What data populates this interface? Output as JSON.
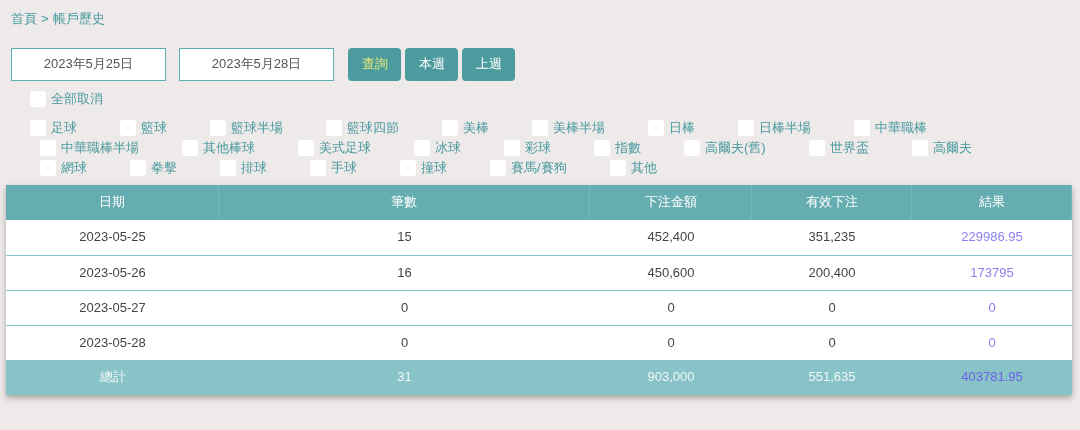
{
  "breadcrumb": [
    "首頁",
    ">",
    "帳戶歷史"
  ],
  "date_from": {
    "value": "2023年5月25日"
  },
  "date_to": {
    "value": "2023年5月28日"
  },
  "buttons": [
    {
      "label": "查詢",
      "selected": true
    },
    {
      "label": "本週",
      "selected": false
    },
    {
      "label": "上週",
      "selected": false
    }
  ],
  "clear_all": {
    "label": "全部取消",
    "checked": false
  },
  "sport_rows": [
    [
      {
        "label": "足球",
        "checked": false
      },
      {
        "label": "籃球",
        "checked": false
      },
      {
        "label": "籃球半場",
        "checked": false
      },
      {
        "label": "籃球四節",
        "checked": false
      },
      {
        "label": "美棒",
        "checked": false
      },
      {
        "label": "美棒半場",
        "checked": false
      },
      {
        "label": "日棒",
        "checked": false
      },
      {
        "label": "日棒半場",
        "checked": false
      },
      {
        "label": "中華職棒",
        "checked": false
      }
    ],
    [
      {
        "label": "中華職棒半場",
        "checked": false
      },
      {
        "label": "其他棒球",
        "checked": false
      },
      {
        "label": "美式足球",
        "checked": false
      },
      {
        "label": "冰球",
        "checked": false
      },
      {
        "label": "彩球",
        "checked": false
      },
      {
        "label": "指數",
        "checked": false
      },
      {
        "label": "高爾夫(舊)",
        "checked": false
      },
      {
        "label": "世界盃",
        "checked": false
      },
      {
        "label": "高爾夫",
        "checked": false
      }
    ],
    [
      {
        "label": "網球",
        "checked": false
      },
      {
        "label": "拳擊",
        "checked": false
      },
      {
        "label": "排球",
        "checked": false
      },
      {
        "label": "手球",
        "checked": false
      },
      {
        "label": "撞球",
        "checked": false
      },
      {
        "label": "賽馬/賽狗",
        "checked": false
      },
      {
        "label": "其他",
        "checked": false
      }
    ]
  ],
  "table": {
    "columns": [
      "日期",
      "筆數",
      "下注金額",
      "有效下注",
      "結果"
    ],
    "rows": [
      [
        "2023-05-25",
        "15",
        "452,400",
        "351,235",
        "229986.95"
      ],
      [
        "2023-05-26",
        "16",
        "450,600",
        "200,400",
        "173795"
      ],
      [
        "2023-05-27",
        "0",
        "0",
        "0",
        "0"
      ],
      [
        "2023-05-28",
        "0",
        "0",
        "0",
        "0"
      ]
    ],
    "total": [
      "總計",
      "31",
      "903,000",
      "551,635",
      "403781.95"
    ]
  }
}
